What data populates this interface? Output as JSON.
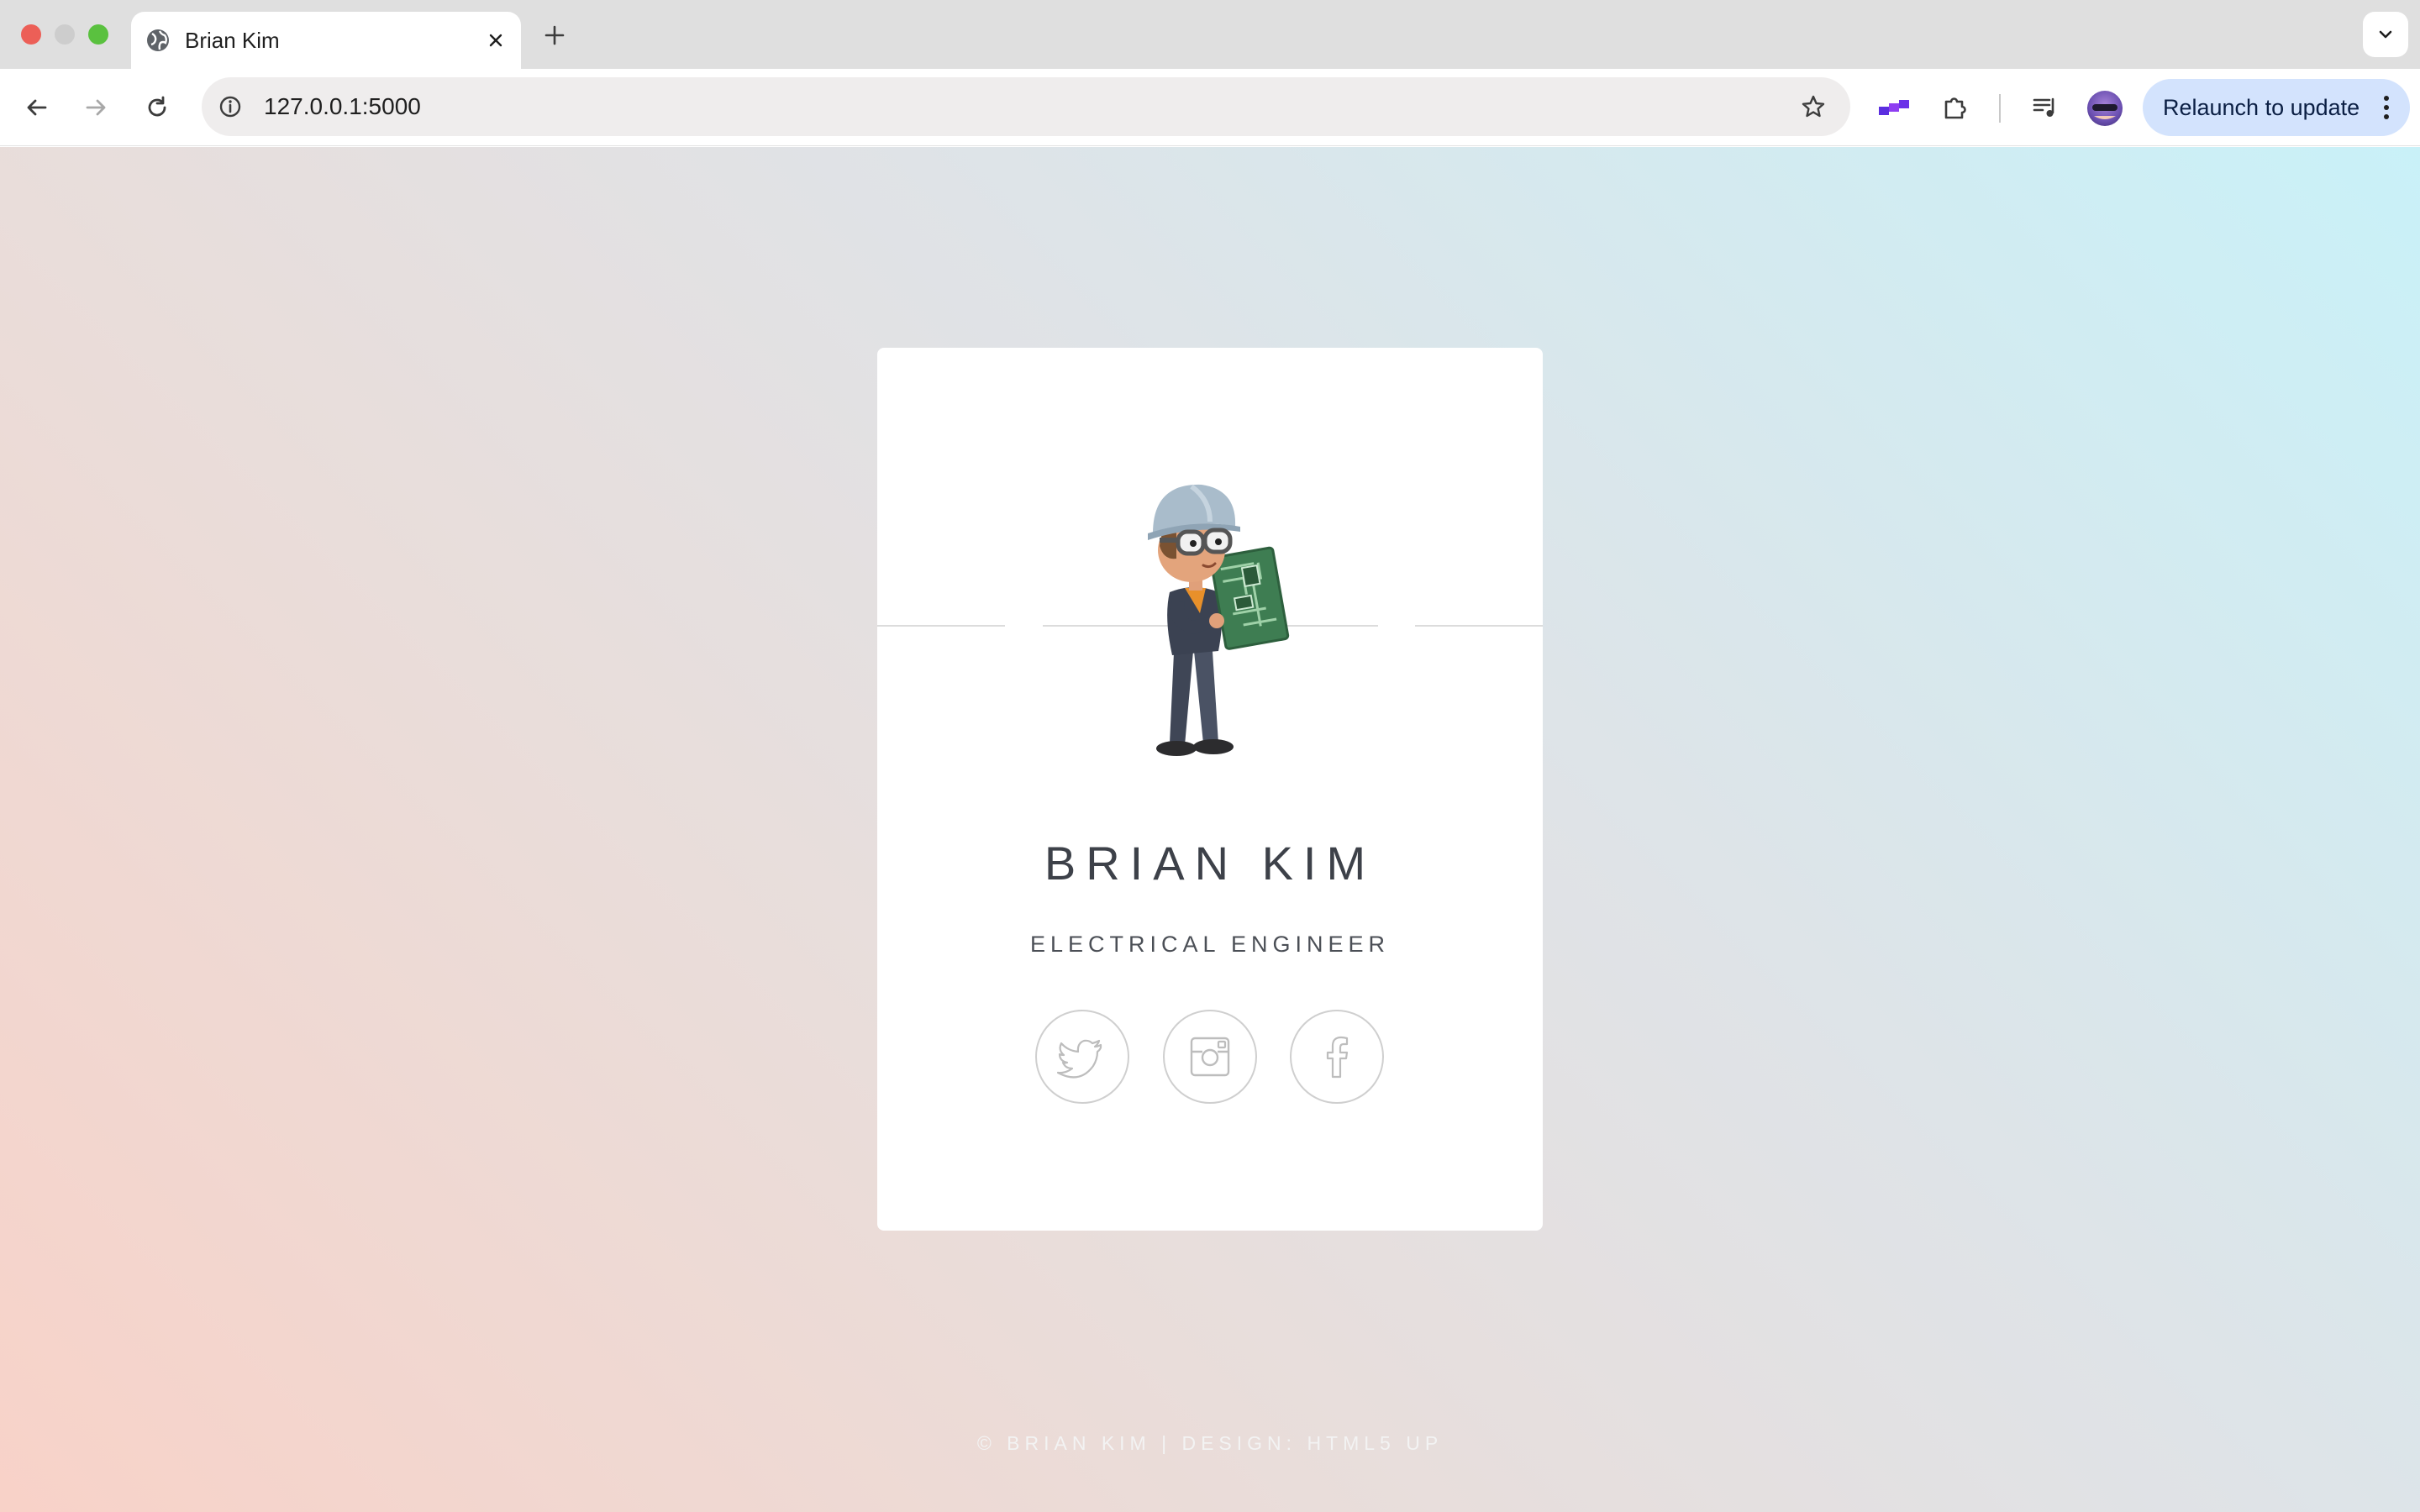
{
  "browser": {
    "tab": {
      "title": "Brian Kim",
      "icon": "globe-icon"
    },
    "address_bar": {
      "url": "127.0.0.1:5000"
    },
    "relaunch_button": {
      "label": "Relaunch to update"
    },
    "icons": [
      "back-arrow-icon",
      "forward-arrow-icon",
      "reload-icon",
      "site-info-icon",
      "bookmark-star-icon",
      "extension-icon",
      "puzzle-icon",
      "media-queue-icon",
      "profile-avatar-icon",
      "more-vert-icon"
    ]
  },
  "profile": {
    "name": "BRIAN KIM",
    "title": "ELECTRICAL ENGINEER",
    "social": [
      {
        "name": "twitter",
        "icon": "twitter-icon"
      },
      {
        "name": "instagram",
        "icon": "instagram-icon"
      },
      {
        "name": "facebook",
        "icon": "facebook-icon"
      }
    ]
  },
  "footer": {
    "text": "© BRIAN KIM | DESIGN: HTML5 UP"
  },
  "colors": {
    "background_gradient_start": "#f8d2c8",
    "background_gradient_end": "#c9f1f8",
    "card": "#ffffff",
    "name_text": "#3d4149",
    "relaunch_bg": "#d3e3fd"
  }
}
